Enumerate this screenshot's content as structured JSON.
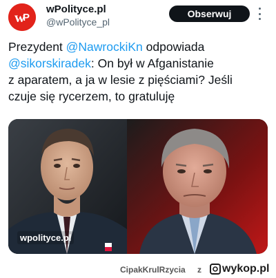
{
  "account": {
    "name": "wPolityce.pl",
    "handle": "@wPolityce_pl",
    "avatar_icon": "wp-logo",
    "avatar_color": "#e2231a"
  },
  "follow_button": {
    "label": "Obserwuj"
  },
  "tweet": {
    "line1_pre": "Prezydent ",
    "line1_mention": "@NawrockiKn",
    "line1_post": " odpowiada",
    "line2_mention": "@sikorskiradek",
    "line2_post": ": On był w Afganistanie",
    "line3": "z aparatem, a ja w lesie z pięściami? Jeśli",
    "line4": "czuje się rycerzem, to gratuluję"
  },
  "media": {
    "watermark": "wpolityce.pl",
    "left_photo": "portrait-man-dark-suit",
    "right_photo": "portrait-man-gray-hair"
  },
  "footer": {
    "user": "CipakKrulRzycia",
    "connector": "z",
    "site": "wykop.pl"
  },
  "colors": {
    "mention": "#1d9bf0",
    "follow_button_bg": "#0f1419",
    "handle": "#536471"
  }
}
